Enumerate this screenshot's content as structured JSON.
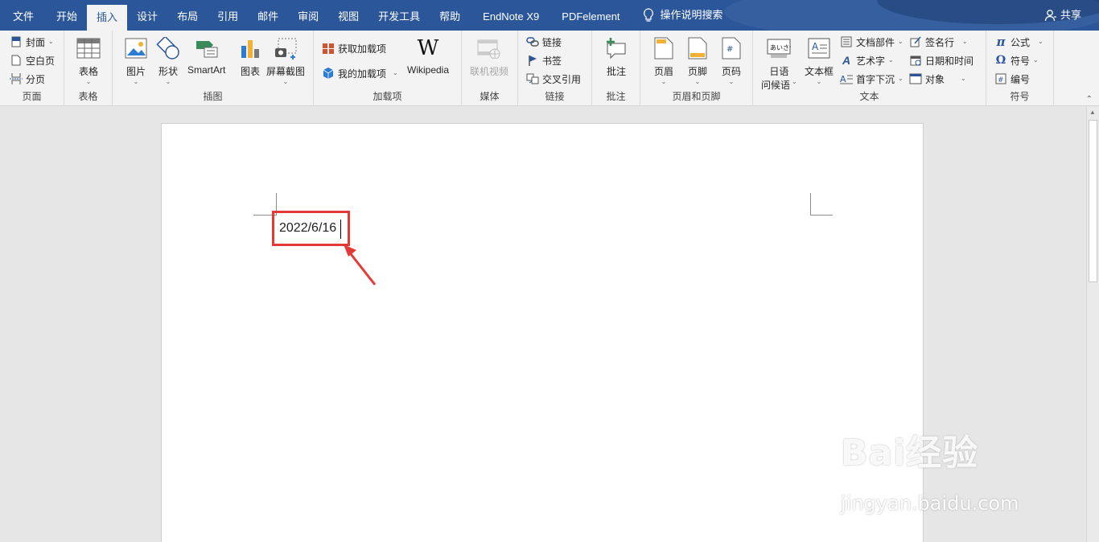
{
  "tabs": [
    "文件",
    "开始",
    "插入",
    "设计",
    "布局",
    "引用",
    "邮件",
    "审阅",
    "视图",
    "开发工具",
    "帮助",
    "EndNote X9",
    "PDFelement"
  ],
  "tell_me": "操作说明搜索",
  "share": "共享",
  "ribbon": {
    "pages": {
      "label": "页面",
      "cover": "封面",
      "blank": "空白页",
      "break": "分页"
    },
    "tables": {
      "label": "表格",
      "table": "表格"
    },
    "illustrations": {
      "label": "插图",
      "pictures": "图片",
      "shapes": "形状",
      "smartart": "SmartArt",
      "chart": "图表",
      "screenshot": "屏幕截图"
    },
    "addins": {
      "label": "加载项",
      "get": "获取加载项",
      "my": "我的加载项",
      "wiki": "Wikipedia"
    },
    "media": {
      "label": "媒体",
      "video": "联机视频"
    },
    "links": {
      "label": "链接",
      "link": "链接",
      "bookmark": "书签",
      "crossref": "交叉引用"
    },
    "comments": {
      "label": "批注",
      "comment": "批注"
    },
    "header_footer": {
      "label": "页眉和页脚",
      "header": "页眉",
      "footer": "页脚",
      "page_number": "页码"
    },
    "text": {
      "label": "文本",
      "greeting_1": "日语",
      "greeting_2": "问候语",
      "textbox": "文本框",
      "quickparts": "文档部件",
      "wordart": "艺术字",
      "dropcap": "首字下沉",
      "signature": "签名行",
      "datetime": "日期和时间",
      "object": "对象"
    },
    "symbols": {
      "label": "符号",
      "equation": "公式",
      "symbol": "符号",
      "numbering": "编号"
    }
  },
  "document": {
    "date_text": "2022/6/16"
  },
  "watermark": {
    "main": "Bai经验",
    "sub": "jingyan.baidu.com"
  },
  "colors": {
    "accent": "#2b579a",
    "highlight": "#e53935"
  }
}
